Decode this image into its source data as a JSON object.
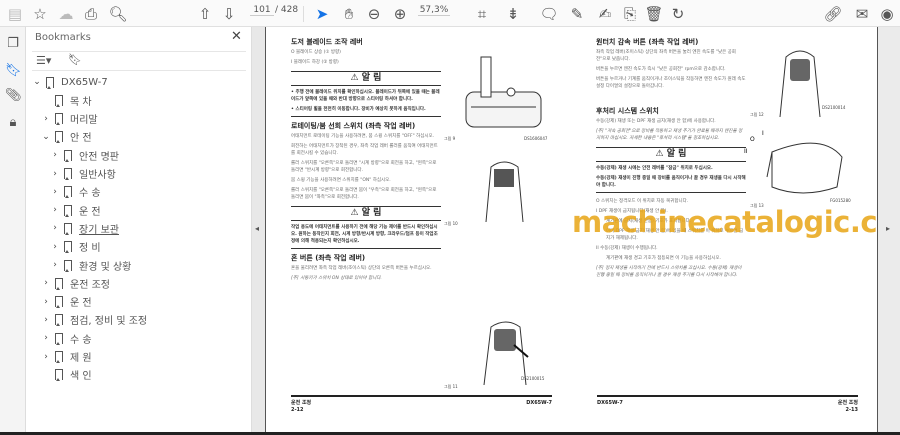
{
  "toolbar": {
    "page_current": "101",
    "page_total": "/ 428",
    "zoom": "57,3%",
    "icons": [
      "save-icon",
      "bookmark-star-icon",
      "cloud-upload-icon",
      "print-icon",
      "zoom-search-icon",
      "prev-page-icon",
      "next-page-icon",
      "select-cursor-icon",
      "hand-icon",
      "zoom-out-icon",
      "zoom-in-icon",
      "fit-page-icon",
      "scroll-mode-icon",
      "comment-icon",
      "pen-icon",
      "sign-icon",
      "stamp-icon",
      "delete-icon",
      "rotate-icon",
      "share-link-icon",
      "email-icon",
      "account-icon"
    ]
  },
  "panel": {
    "title": "Bookmarks",
    "close": "✕",
    "bookmarks": [
      {
        "label": "DX65W-7",
        "level": 0,
        "chev": "⌄"
      },
      {
        "label": "목 차",
        "level": 1,
        "chev": ""
      },
      {
        "label": "머리말",
        "level": 1,
        "chev": "›"
      },
      {
        "label": "안 전",
        "level": 1,
        "chev": "⌄"
      },
      {
        "label": "안전 명판",
        "level": 2,
        "chev": "›"
      },
      {
        "label": "일반사항",
        "level": 2,
        "chev": "›"
      },
      {
        "label": "수 송",
        "level": 2,
        "chev": "›"
      },
      {
        "label": "운 전",
        "level": 2,
        "chev": "›"
      },
      {
        "label": "장기 보관",
        "level": 2,
        "chev": "›"
      },
      {
        "label": "정 비",
        "level": 2,
        "chev": "›"
      },
      {
        "label": "환경 및 상황",
        "level": 2,
        "chev": "›"
      },
      {
        "label": "운전 조정",
        "level": 1,
        "chev": "›"
      },
      {
        "label": "운 전",
        "level": 1,
        "chev": "›"
      },
      {
        "label": "점검, 정비 및 조정",
        "level": 1,
        "chev": "›"
      },
      {
        "label": "수 송",
        "level": 1,
        "chev": "›"
      },
      {
        "label": "제 원",
        "level": 1,
        "chev": "›"
      },
      {
        "label": "색 인",
        "level": 1,
        "chev": ""
      }
    ]
  },
  "left_page": {
    "h1": "도저 블레이드 조작 레버",
    "o": "O   블레이드 상승 (① 방향)",
    "i": "I    블레이드 하강 (② 방향)",
    "warn1_title": "알 림",
    "warn1_b1": "• 주행 전에 블레이드 위치를 확인하십시오. 블레이드가 뒤쪽에 있을 때는 블레이드가 앞쪽에 있을 때와 반대 방향으로 스티어링 하셔야 합니다.",
    "warn1_b2": "• 스티어링 휠을 천천히 이동합니다. 장비가 예상치 못하게 움직입니다.",
    "fig9": "그림 9",
    "fig9_code": "DS1606047",
    "h2": "로테이팅/붐 선회 스위치 (좌측 작업 레버)",
    "p1": "어태치먼트 로테이팅 기능을 사용하려면, 붐 스윙 스위치를 \"OFF\" 하십시오.",
    "p2": "회전하는 어태치먼트가 장착된 경우, 좌측 작업 레버 롤러를 움직여 어태치먼트를 회전시킬 수 있습니다.",
    "p3": "롤러 스위치를 \"오른쪽\"으로 돌리면 \"시계 방향\"으로 회전을 하고, \"왼쪽\"으로 돌리면 \"반시계 방향\"으로 회전합니다.",
    "p4": "붐 스윙 기능을 사용하려면 스위치를 \"ON\" 하십시오.",
    "p5": "롤러 스위치를 \"오른쪽\"으로 돌리면 붐이 \"우측\"으로 회전을 하고, \"왼쪽\"으로 돌리면 붐이 \"좌측\"으로 회전합니다.",
    "fig10": "그림 10",
    "warn2_title": "알 림",
    "warn2_text": "작업 용도에 어태치먼트를 사용하기 전에 해당 기능 제어를 반드시 확인하십시오. 원하는 동작인지 회전, 시계 방향/반시계 방향, 크라우드/덤프 등이 작업조정에 의해 적용되는지 확인하십시오.",
    "h3": "혼 버튼 (좌측 작업 레버)",
    "p6": "혼을 울리려면 좌측 작업 레버(조이스틱) 상단의 오른쪽 버튼을 누르십시오.",
    "note": "[주]  시동키가 스위치 ON 상태로 있어야 합니다.",
    "fig11": "그림 11",
    "fig11_code": "DS2100015",
    "footer_left": "운전 조정",
    "footer_page": "2-12",
    "footer_right": "DX65W-7"
  },
  "right_page": {
    "h1": "원터치 감속 버튼 (좌측 작업 레버)",
    "p1": "좌측 작업 레버(조이스틱) 상단의 좌측 버튼을 눌러 엔진 속도를 \"낮은 공회전\"으로 낮춥니다.",
    "p2": "버튼을 누르면 엔진 속도가 즉시 \"낮은 공회전\" rpm으로 감소합니다.",
    "p3": "버튼을 누르거나 기계를 움직이거나 조이스틱을 작동하면 엔진 속도가 원래 속도 설정 다이얼의 설정으로 돌아갑니다.",
    "fig12": "그림 12",
    "fig12_code": "DS2100014",
    "h2": "후처리 시스템 스위치",
    "p4": "수동(강제) 재생 또는 DPF 재생 금지(재생 안 함)에 사용합니다.",
    "note1": "[주]  \"저속 공회전\"으로 장비를 작동하고 재생 주기가 완료될 때까지 엔진을 정지하지 마십시오. 자세한 내용은 \"후처리 시스템\"을 참조하십시오.",
    "warn_title": "알 림",
    "warn_l1": "수동(강제) 재생 시에는 안전 레버를 \"잠금\" 위치로 두십시오.",
    "warn_l2": "수동(강제) 재생이 진행 중일 때 장비를 움직이거나 끌 경우 재생을 다시 시작해야 합니다.",
    "fig13": "그림 13",
    "fig13_code": "FG015280",
    "fig13_labels": [
      "O",
      "I",
      "II"
    ],
    "o": "O    스위치는 정격모드 이 위치로 자동 복귀합니다.",
    "i": "I     DPF 재생이 금지됩니다(재생 안 함).",
    "i2": "계기판에 금지(재생 안함) 기호가 표시됩니다.",
    "i3": "이미 DPF 재생 금지(재생 안 함)에 있을 때 스위치를 이 위치로 누르면 금지가 해제됩니다.",
    "ii": "II    수동(강제) 재생이 수행됩니다.",
    "ii2": "계기판에 재생 경고 기호가 점등되면 이 기능을 사용하십시오.",
    "note2": "[주]  정지 재생을 시작하기 전에 반드시 스위치를 끄십시오. 수동(강제) 재생이 진행 중일 때 장비를 움직이거나 끌 경우 재생 주기를 다시 시작해야 합니다.",
    "footer_left": "DX65W-7",
    "footer_right": "운전 조정",
    "footer_page": "2-13"
  },
  "watermark": "machinecatalogic.com"
}
